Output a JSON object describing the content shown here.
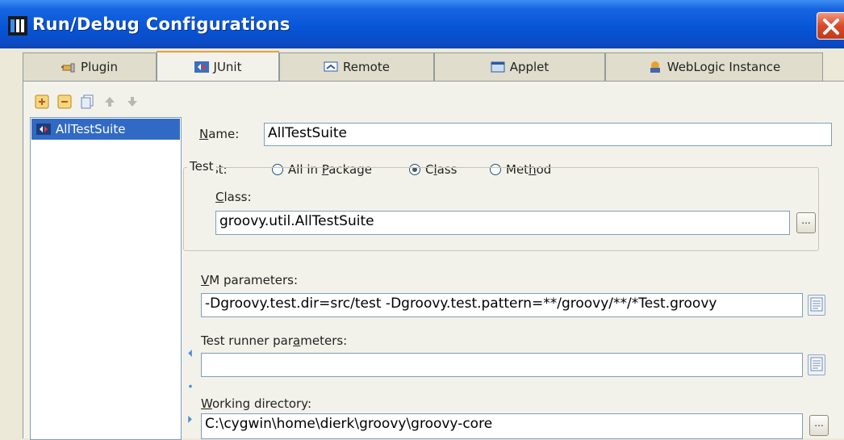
{
  "window": {
    "title": "Run/Debug Configurations"
  },
  "tabs": [
    {
      "label": "Plugin",
      "icon": "plugin-icon"
    },
    {
      "label": "JUnit",
      "icon": "junit-icon",
      "active": true
    },
    {
      "label": "Remote",
      "icon": "remote-icon"
    },
    {
      "label": "Applet",
      "icon": "applet-icon"
    },
    {
      "label": "WebLogic Instance",
      "icon": "weblogic-icon"
    }
  ],
  "toolbar": {
    "icons": [
      "add-icon",
      "remove-icon",
      "copy-icon",
      "move-up-icon",
      "move-down-icon"
    ]
  },
  "configs": [
    {
      "label": "AllTestSuite",
      "selected": true
    }
  ],
  "form": {
    "name_label_pre": "",
    "name_label_u": "N",
    "name_label_post": "ame:",
    "name_value": "AllTestSuite",
    "test_label": "Test:",
    "radios": [
      {
        "pre": "All in ",
        "u": "P",
        "post": "ackage",
        "checked": false
      },
      {
        "pre": "C",
        "u": "l",
        "post": "ass",
        "checked": true
      },
      {
        "pre": "Met",
        "u": "h",
        "post": "od",
        "checked": false
      }
    ],
    "group_title": "Test",
    "class_label_u": "C",
    "class_label_post": "lass:",
    "class_value": "groovy.util.AllTestSuite",
    "browse_label": "...",
    "vm_label_u": "V",
    "vm_label_post": "M parameters:",
    "vm_value": "-Dgroovy.test.dir=src/test -Dgroovy.test.pattern=**/groovy/**/*Test.groovy",
    "runner_label_pre": "Test runner par",
    "runner_label_u": "a",
    "runner_label_post": "meters:",
    "runner_value": "",
    "workdir_label_u": "W",
    "workdir_label_post": "orking directory:",
    "workdir_value": "C:\\cygwin\\home\\dierk\\groovy\\groovy-core"
  },
  "colors": {
    "title_bar": "#0a52d6",
    "selection": "#316ac5",
    "close": "#d9492a",
    "active_tab_accent": "#e6a33b"
  }
}
